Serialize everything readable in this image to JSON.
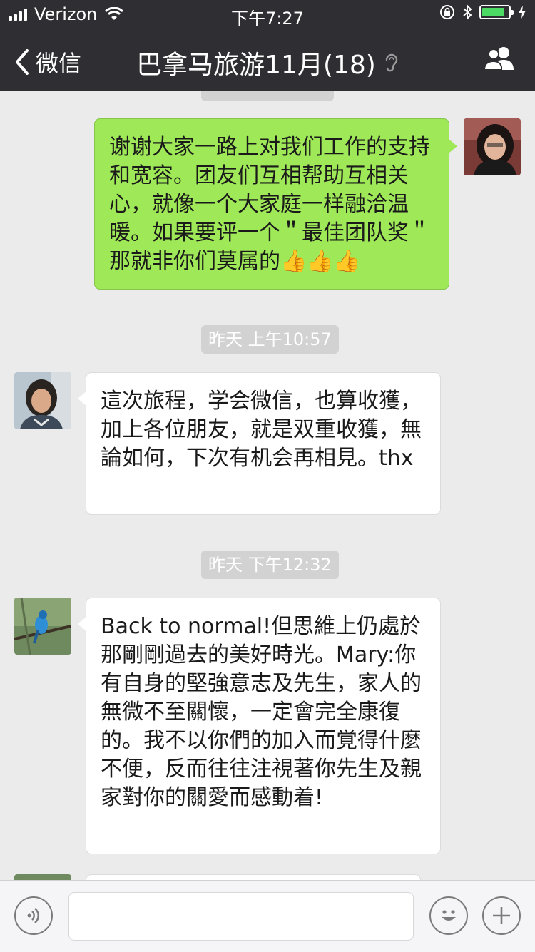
{
  "status_bar": {
    "carrier": "Verizon",
    "time": "下午7:27",
    "battery_color": "#4cd964",
    "battery_level": 0.85
  },
  "nav": {
    "back_label": "微信",
    "title": "巴拿马旅游11月(18)",
    "muted_icon": "ear-icon",
    "contacts_icon": "group-icon"
  },
  "messages": [
    {
      "side": "out",
      "text": "谢谢大家一路上对我们工作的支持和宽容。团友们互相帮助互相关心，就像一个大家庭一样融洽温暖。如果要评一个＂最佳团队奖＂那就非你们莫属的",
      "emoji": "👍👍👍"
    },
    {
      "timestamp": "昨天 上午10:57"
    },
    {
      "side": "in",
      "text": "這次旅程，学会微信，也算收獲，加上各位朋友，就是双重收獲，無論如何，下次有机会再相見。thx"
    },
    {
      "timestamp": "昨天 下午12:32"
    },
    {
      "side": "in",
      "text": "Back to normal!但思維上仍處於那剛剛過去的美好時光。Mary:你有自身的堅強意志及先生，家人的無微不至關懷，一定會完全康復的。我不以你們的加入而覚得什麼不便，反而往往注視著你先生及親家對你的關愛而感動着!"
    }
  ],
  "input_bar": {
    "voice_icon": "voice-icon",
    "emoji_icon": "emoji-icon",
    "plus_icon": "plus-icon",
    "input_value": ""
  },
  "colors": {
    "header_bg": "#2e2e33",
    "chat_bg": "#ebebeb",
    "outgoing_bubble": "#9fe858",
    "incoming_bubble": "#ffffff",
    "timestamp_bg": "#d2d2d2"
  }
}
